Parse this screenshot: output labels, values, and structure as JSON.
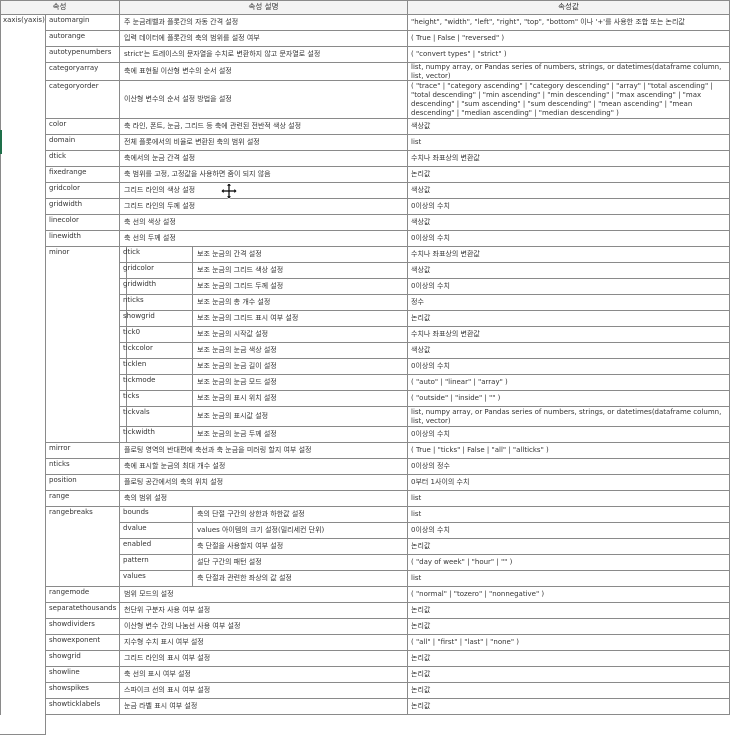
{
  "header": {
    "col_property": "속성",
    "col_description": "속성 설명",
    "col_value": "속성값"
  },
  "root_property": "xaxis(yaxis)",
  "rows": [
    {
      "name": "automargin",
      "desc": "주 눈금레벨과 플롯간의 자동 간격 설정",
      "value": "\"height\", \"width\", \"left\", \"right\", \"top\", \"bottom\" 이나 '+'를 사용한 조합 또는 논리값"
    },
    {
      "name": "autorange",
      "desc": "입력 데이터에 플롯간의 축의 범위를 설정 여부",
      "value": "( True | False | \"reversed\" )"
    },
    {
      "name": "autotypenumbers",
      "desc": "strict'는 트레이스의 문자열을 수치로 변환하지 않고 문자열로 설정",
      "value": "( \"convert types\" | \"strict\" )"
    },
    {
      "name": "categoryarray",
      "desc": "축에 표현될 이산형 변수의 순서 설정",
      "value": "list, numpy array, or Pandas series of numbers, strings, or datetimes(dataframe column, list, vector)"
    },
    {
      "name": "categoryorder",
      "desc": "이산형 변수의 순서 설정 방법을 설정",
      "value": "( \"trace\" | \"category ascending\" | \"category descending\" | \"array\" | \"total ascending\" | \"total descending\" | \"min ascending\" | \"min descending\" | \"max ascending\" | \"max descending\" | \"sum ascending\" | \"sum descending\" | \"mean ascending\" | \"mean descending\" | \"median ascending\" | \"median descending\" )"
    },
    {
      "name": "color",
      "desc": "축 라인, 폰트, 눈금, 그리드 등 축에 관련된 전반적 색상 설정",
      "value": "색상값"
    },
    {
      "name": "domain",
      "desc": "전체 플롯에서의 비율로 변환된 축의 범위 설정",
      "value": "list"
    },
    {
      "name": "dtick",
      "desc": "축에서의 눈금 간격 설정",
      "value": "수치나 좌표상의 변환값"
    },
    {
      "name": "fixedrange",
      "desc": "축 범위를 고정, 고정값을 사용하면 줌이 되지 않음",
      "value": "논리값"
    },
    {
      "name": "gridcolor",
      "desc": "그리드 라인의 색상 설정",
      "value": "색상값"
    },
    {
      "name": "gridwidth",
      "desc": "그리드 라인의 두께 설정",
      "value": "0이상의 수치"
    },
    {
      "name": "linecolor",
      "desc": "축 선의 색상 설정",
      "value": "색상값"
    },
    {
      "name": "linewidth",
      "desc": "축 선의 두께 설정",
      "value": "0이상의 수치"
    },
    {
      "name": "mirror",
      "desc": "플로팅 영역의 반대편에 축선과 축 눈금을 미러링 할지 여부 설정",
      "value": "( True | \"ticks\" | False | \"all\" | \"allticks\" )"
    },
    {
      "name": "nticks",
      "desc": "축에 표시할 눈금의 최대 개수 설정",
      "value": "0이상의 정수"
    },
    {
      "name": "position",
      "desc": "플로팅 공간에서의 축의 위치 설정",
      "value": "0부터 1사이의 수치"
    },
    {
      "name": "range",
      "desc": "축의 범위 설정",
      "value": "list"
    },
    {
      "name": "rangemode",
      "desc": "범위 모드의 설정",
      "value": "( \"normal\" | \"tozero\" | \"nonnegative\" )"
    },
    {
      "name": "separatethousands",
      "desc": "천단위 구분자 사용 여부 설정",
      "value": "논리값"
    },
    {
      "name": "showdividers",
      "desc": "이산형 변수 간의 나눔선 사용 여부 설정",
      "value": "논리값"
    },
    {
      "name": "showexponent",
      "desc": "지수형 수치 표시 여부 설정",
      "value": "( \"all\" | \"first\" | \"last\" | \"none\" )"
    },
    {
      "name": "showgrid",
      "desc": "그리드 라인의 표시 여부 설정",
      "value": "논리값"
    },
    {
      "name": "showline",
      "desc": "축 선의 표시 여부 설정",
      "value": "논리값"
    },
    {
      "name": "showspikes",
      "desc": "스파이크 선의 표시 여부 설정",
      "value": "논리값"
    },
    {
      "name": "showticklabels",
      "desc": "눈금 라벨 표시 여부 설정",
      "value": "논리값"
    }
  ],
  "minor": {
    "name": "minor",
    "sub": [
      {
        "name": "dtick",
        "desc": "보조 눈금의 간격 설정",
        "value": "수치나 좌표상의 변환값"
      },
      {
        "name": "gridcolor",
        "desc": "보조 눈금의 그리드 색상 설정",
        "value": "색상값"
      },
      {
        "name": "gridwidth",
        "desc": "보조 눈금의 그리드 두께 설정",
        "value": "0이상의 수치"
      },
      {
        "name": "nticks",
        "desc": "보조 눈금의 총 개수 설정",
        "value": "정수"
      },
      {
        "name": "showgrid",
        "desc": "보조 눈금의 그리드 표시 여부 설정",
        "value": "논리값"
      },
      {
        "name": "tick0",
        "desc": "보조 눈금의 시작값 설정",
        "value": "수치나 좌표상의 변환값"
      },
      {
        "name": "tickcolor",
        "desc": "보조 눈금의 눈금 색상 설정",
        "value": "색상값"
      },
      {
        "name": "ticklen",
        "desc": "보조 눈금의 눈금 길이 설정",
        "value": "0이상의 수치"
      },
      {
        "name": "tickmode",
        "desc": "보조 눈금의 눈금 모드 설정",
        "value": "( \"auto\" | \"linear\" | \"array\" )"
      },
      {
        "name": "ticks",
        "desc": "보조 눈금의 표시 위치 설정",
        "value": "( \"outside\" | \"inside\" | \"\" )"
      },
      {
        "name": "tickvals",
        "desc": "보조 눈금의 표시값 설정",
        "value": "list, numpy array, or Pandas series of numbers, strings, or datetimes(dataframe column, list, vector)"
      },
      {
        "name": "tickwidth",
        "desc": "보조 눈금의 눈금 두께 설정",
        "value": "0이상의 수치"
      }
    ]
  },
  "rangebreaks": {
    "name": "rangebreaks",
    "sub": [
      {
        "name": "bounds",
        "desc": "축의 단절 구간의 상한과 하한값 설정",
        "value": "list"
      },
      {
        "name": "dvalue",
        "desc": "values 아이템의 크기 설정(밀리세컨 단위)",
        "value": "0이상의 수치"
      },
      {
        "name": "enabled",
        "desc": "축 단절을 사용할지 여부 설정",
        "value": "논리값"
      },
      {
        "name": "pattern",
        "desc": "설단 구간의 패턴 설정",
        "value": "( \"day of week\" | \"hour\" | \"\" )"
      },
      {
        "name": "values",
        "desc": "축 단절과 관련한 좌상의 값 설정",
        "value": "list"
      }
    ]
  }
}
